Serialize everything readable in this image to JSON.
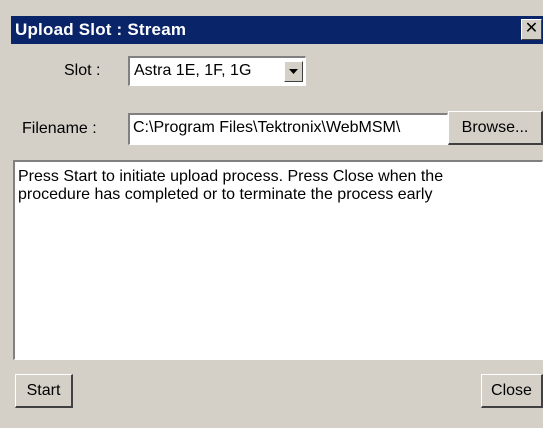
{
  "window": {
    "title": "Upload Slot : Stream",
    "close_glyph": "✕"
  },
  "slot": {
    "label": "Slot :",
    "selected": "Astra 1E, 1F, 1G"
  },
  "filename": {
    "label": "Filename :",
    "value": "C:\\Program Files\\Tektronix\\WebMSM\\",
    "browse_label": "Browse..."
  },
  "message": {
    "line1": "Press Start to initiate upload process. Press Close when the",
    "line2": "procedure has completed or to terminate the process early"
  },
  "buttons": {
    "start_label": "Start",
    "close_label": "Close"
  },
  "colors": {
    "titlebar": "#0a246a",
    "face": "#d4d0c8"
  },
  "icons": {
    "dropdown": "chevron-down-icon",
    "close": "close-icon"
  }
}
